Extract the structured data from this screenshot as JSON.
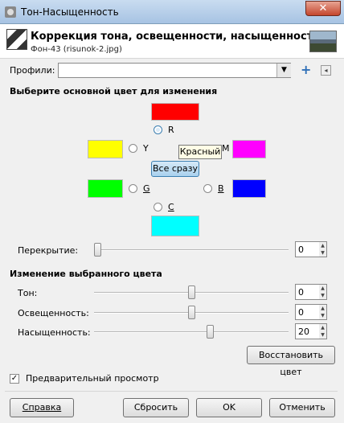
{
  "window": {
    "title": "Тон-Насыщенность",
    "close": "✕"
  },
  "header": {
    "title": "Коррекция тона, освещенности, насыщенности",
    "subtitle": "Фон-43 (risunok-2.jpg)"
  },
  "profiles": {
    "label": "Профили:",
    "value": "",
    "add_icon": "+",
    "menu_icon": "◂"
  },
  "primary": {
    "heading": "Выберите основной цвет для изменения",
    "colors": {
      "red": "#ff0000",
      "yellow": "#ffff00",
      "magenta": "#ff00ff",
      "green": "#00ff00",
      "blue": "#0000ff",
      "cyan": "#00ffff"
    },
    "labels": {
      "r": "R",
      "y": "Y",
      "m": "M",
      "g": "G",
      "b": "B",
      "c": "C"
    },
    "tooltip": "Красный",
    "all_button": "Все сразу"
  },
  "overlap": {
    "label": "Перекрытие:",
    "value": "0",
    "level": 0
  },
  "edit": {
    "heading": "Изменение выбранного цвета",
    "hue": {
      "label": "Тон:",
      "value": "0",
      "level": 0.5
    },
    "lightness": {
      "label": "Освещенность:",
      "value": "0",
      "level": 0.5
    },
    "saturation": {
      "label": "Насыщенность:",
      "value": "20",
      "level": 0.6
    },
    "reset_button": "Восстановить цвет"
  },
  "preview": {
    "label": "Предварительный просмотр",
    "checked": true
  },
  "buttons": {
    "help": "Справка",
    "reset": "Сбросить",
    "ok": "OK",
    "cancel": "Отменить"
  }
}
